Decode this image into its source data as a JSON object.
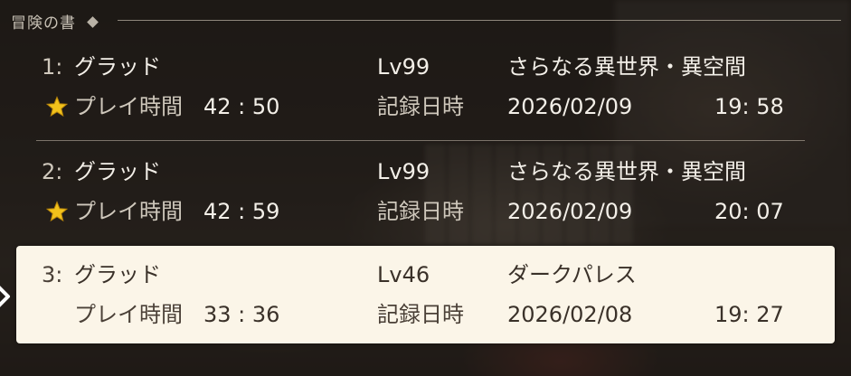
{
  "header": {
    "title": "冒険の書"
  },
  "slots": [
    {
      "number": "1:",
      "name": "グラッド",
      "level": "Lv99",
      "location": "さらなる異世界・異空間",
      "playtime_label": "プレイ時間",
      "playtime": "42 : 50",
      "record_label": "記録日時",
      "date": "2026/02/09",
      "time": "19: 58",
      "star": true,
      "selected": false
    },
    {
      "number": "2:",
      "name": "グラッド",
      "level": "Lv99",
      "location": "さらなる異世界・異空間",
      "playtime_label": "プレイ時間",
      "playtime": "42 : 59",
      "record_label": "記録日時",
      "date": "2026/02/09",
      "time": "20: 07",
      "star": true,
      "selected": false
    },
    {
      "number": "3:",
      "name": "グラッド",
      "level": "Lv46",
      "location": "ダークパレス",
      "playtime_label": "プレイ時間",
      "playtime": "33 : 36",
      "record_label": "記録日時",
      "date": "2026/02/08",
      "time": "19: 27",
      "star": false,
      "selected": true
    }
  ],
  "colors": {
    "selected_background": "#fbf5e8",
    "star": "#f2c21b",
    "text": "#f3efe8"
  },
  "icons": {
    "star": "star-icon",
    "cursor": "chevron-right-icon",
    "header": "diamond-icon"
  }
}
